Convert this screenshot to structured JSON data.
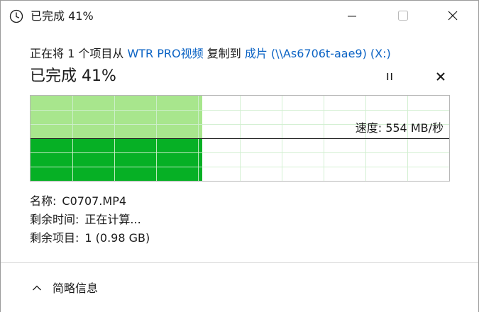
{
  "window": {
    "title": "已完成 41%",
    "icons": {
      "app": "clock-icon",
      "minimize": "minimize-icon",
      "maximize": "maximize-icon",
      "close": "close-icon"
    }
  },
  "copy_line": {
    "prefix": "正在将 1 个项目从 ",
    "source": "WTR PRO视频",
    "middle": " 复制到 ",
    "destination": "成片 (\\\\As6706t-aae9) (X:)"
  },
  "status": {
    "heading": "已完成 41%",
    "percent_complete": 41,
    "pause_icon": "pause-icon",
    "cancel_icon": "cancel-icon"
  },
  "graph": {
    "speed_label": "速度: 554 MB/秒",
    "progress_fraction": 0.41,
    "speed_line_fraction_of_height": 0.5,
    "colors": {
      "history_fill": "#a8e68d",
      "current_fill": "#06b025",
      "grid": "#cfeece",
      "border": "#b7b7b7",
      "speed_line": "#1a1a1a"
    }
  },
  "details": {
    "name_label": "名称:",
    "name_value": "C0707.MP4",
    "time_label": "剩余时间:",
    "time_value": "正在计算...",
    "items_label": "剩余项目:",
    "items_value": "1 (0.98 GB)"
  },
  "footer": {
    "toggle_label": "简略信息",
    "toggle_icon": "chevron-up-icon"
  },
  "colors": {
    "link": "#0b63c4",
    "text": "#1a1a1a",
    "background": "#ffffff"
  }
}
